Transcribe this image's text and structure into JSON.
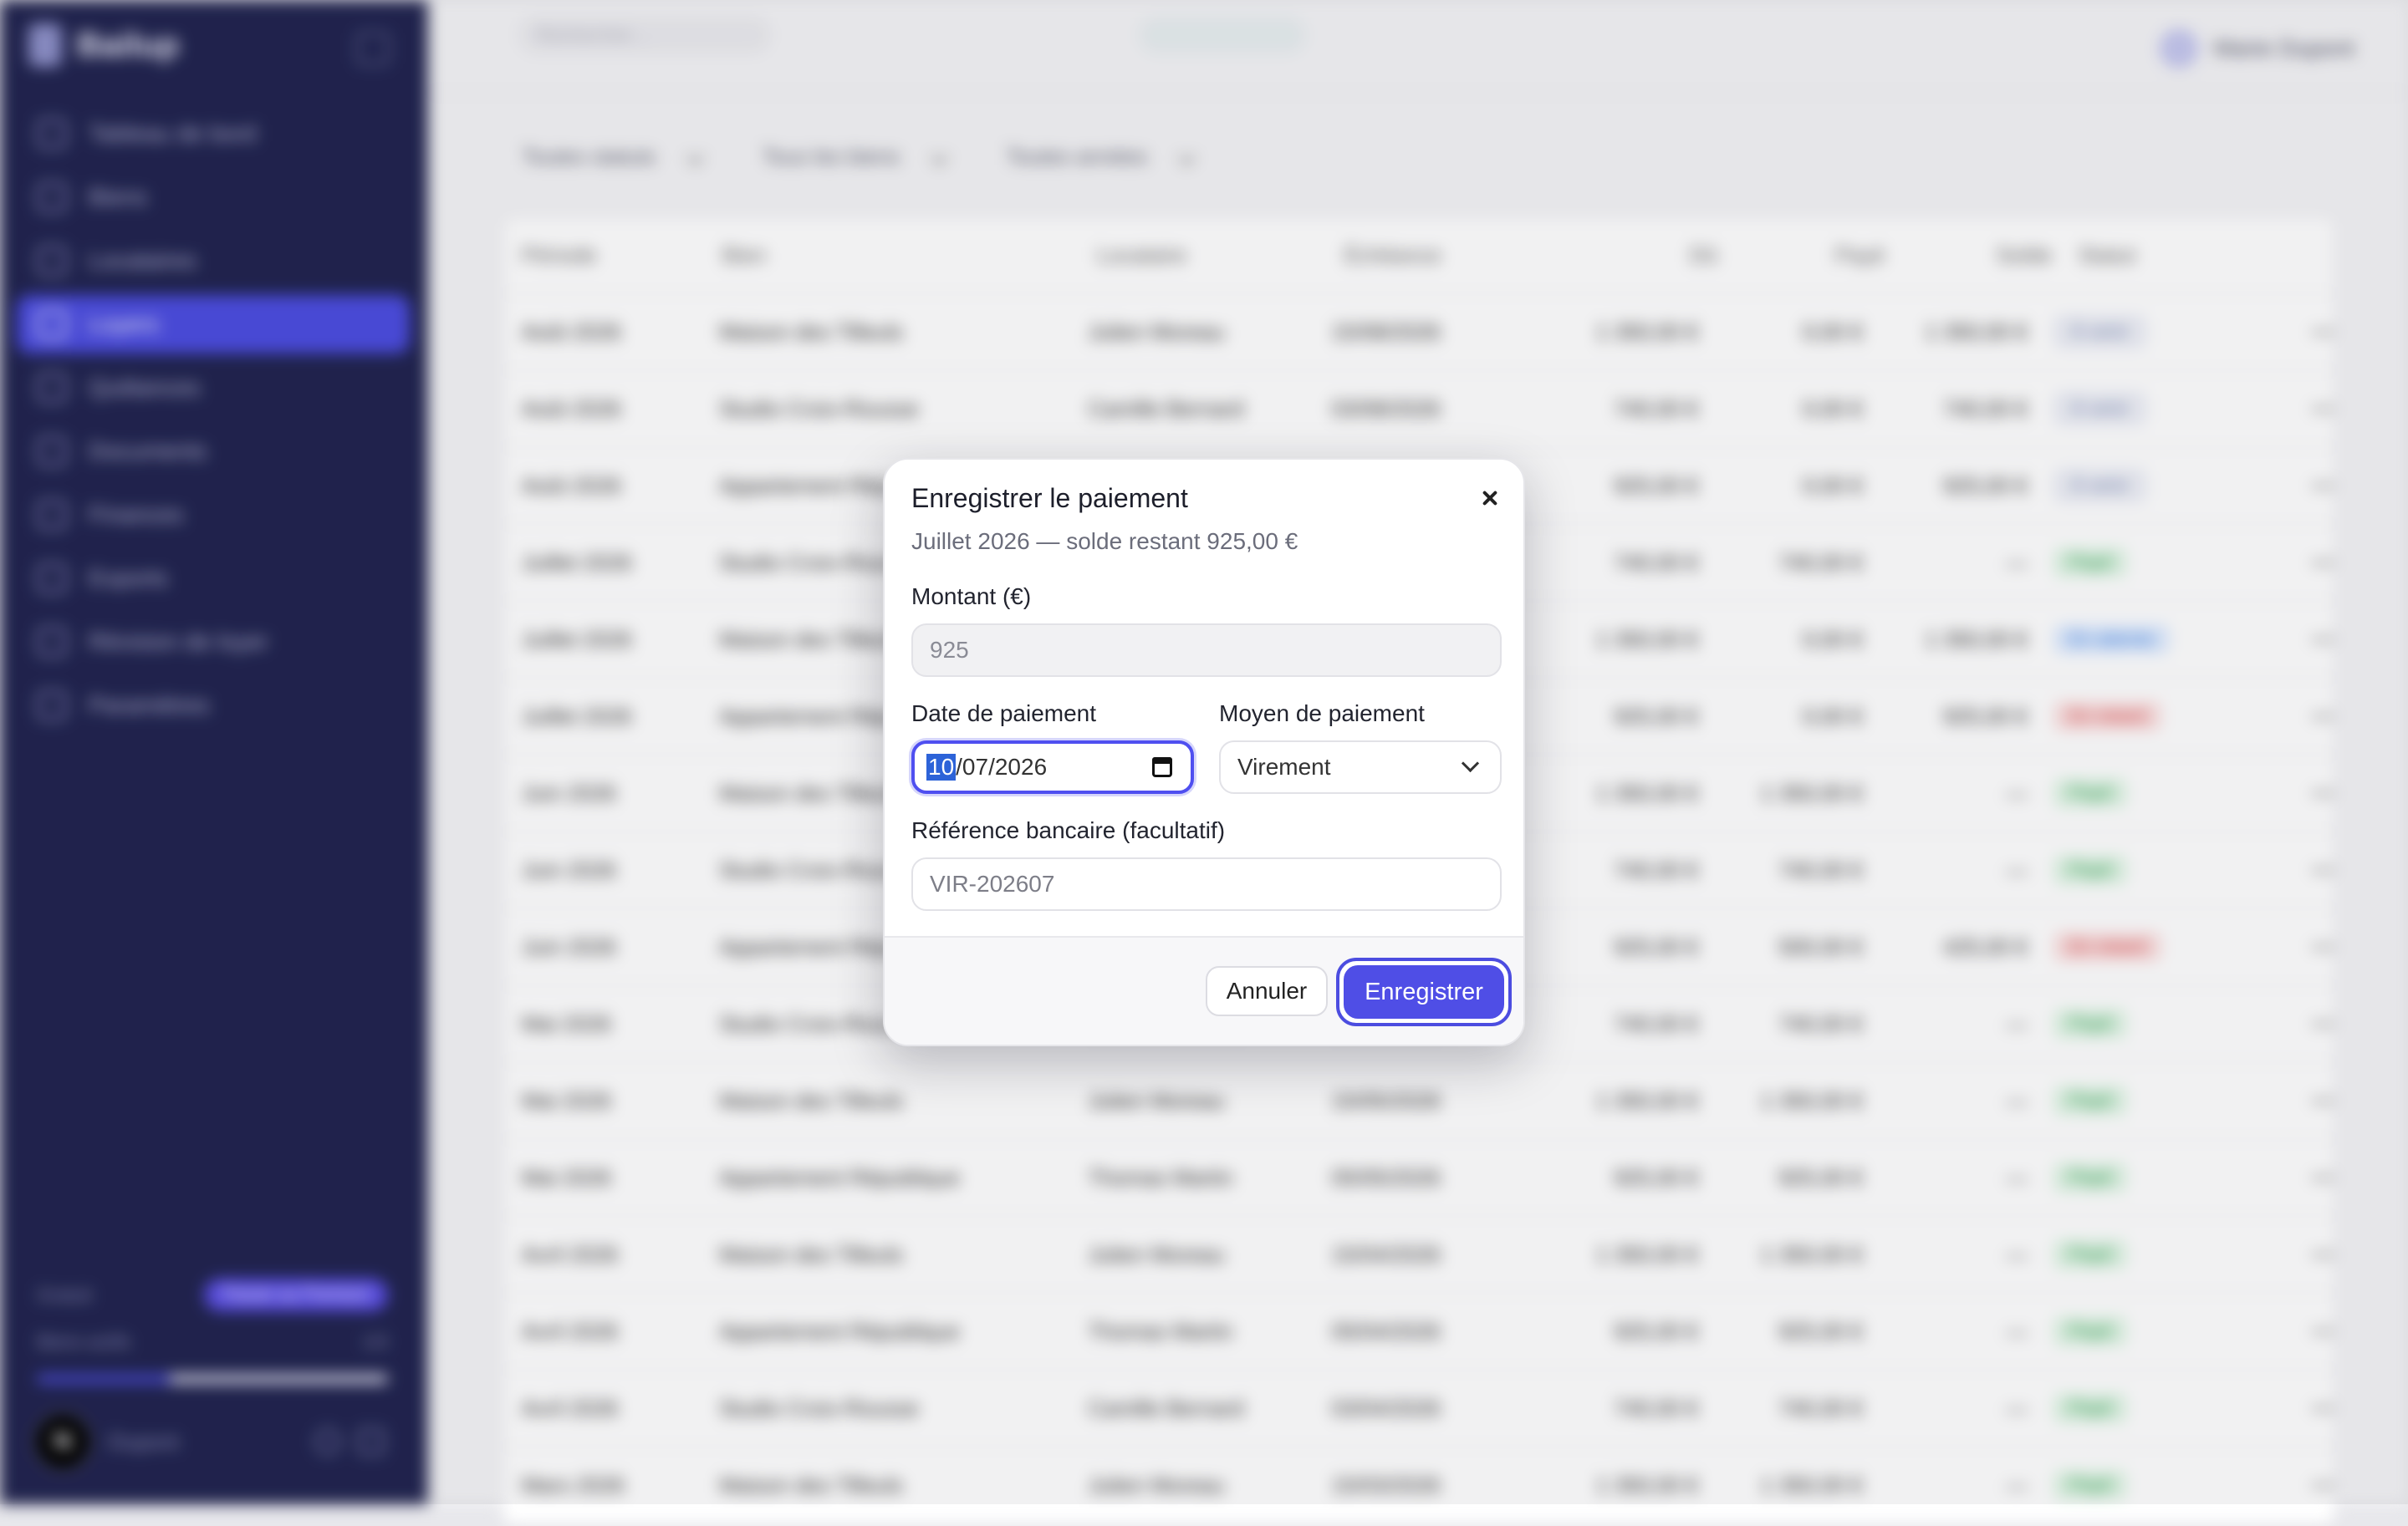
{
  "sidebar": {
    "brand": "Bailup",
    "items": [
      {
        "label": "Tableau de bord"
      },
      {
        "label": "Biens"
      },
      {
        "label": "Locataires"
      },
      {
        "label": "Loyers",
        "active": true
      },
      {
        "label": "Quittances"
      },
      {
        "label": "Documents"
      },
      {
        "label": "Finances"
      },
      {
        "label": "Exports"
      },
      {
        "label": "Révision de loyer"
      },
      {
        "label": "Paramètres"
      }
    ],
    "plan": {
      "name": "Gratuit",
      "badge": "Passer au Premium",
      "usage_label": "Biens actifs",
      "usage_value": "1/3",
      "usage_fraction": 0.38
    },
    "user_initial": "N",
    "user_name": "Dupont"
  },
  "topbar": {
    "search_placeholder": "Rechercher…",
    "user_name": "Marie Dupont"
  },
  "filters": [
    "Toutes statuts",
    "Tous les biens",
    "Toutes années"
  ],
  "table": {
    "headers": [
      "Période",
      "Bien",
      "Locataire",
      "Échéance",
      "Dû",
      "Payé",
      "Solde",
      "Statut"
    ],
    "rows": [
      [
        "Août 2026",
        "Maison des Tilleuls",
        "Julien Moreau",
        "15/08/2026",
        "1 350,00 €",
        "0,00 €",
        "1 350,00 €",
        "À venir"
      ],
      [
        "Août 2026",
        "Studio Croix-Rousse",
        "Camille Bernard",
        "03/08/2026",
        "740,00 €",
        "0,00 €",
        "740,00 €",
        "À venir"
      ],
      [
        "Août 2026",
        "Appartement République",
        "Thomas Martin",
        "05/08/2026",
        "925,00 €",
        "0,00 €",
        "925,00 €",
        "À venir"
      ],
      [
        "Juillet 2026",
        "Studio Croix-Rousse",
        "Camille Bernard",
        "03/07/2026",
        "740,00 €",
        "740,00 €",
        "—",
        "Payé"
      ],
      [
        "Juillet 2026",
        "Maison des Tilleuls",
        "Julien Moreau",
        "15/07/2026",
        "1 350,00 €",
        "0,00 €",
        "1 350,00 €",
        "En attente"
      ],
      [
        "Juillet 2026",
        "Appartement République",
        "Thomas Martin",
        "05/07/2026",
        "925,00 €",
        "0,00 €",
        "925,00 €",
        "En retard"
      ],
      [
        "Juin 2026",
        "Maison des Tilleuls",
        "Julien Moreau",
        "15/06/2026",
        "1 350,00 €",
        "1 350,00 €",
        "—",
        "Payé"
      ],
      [
        "Juin 2026",
        "Studio Croix-Rousse",
        "Camille Bernard",
        "03/06/2026",
        "740,00 €",
        "740,00 €",
        "—",
        "Payé"
      ],
      [
        "Juin 2026",
        "Appartement République",
        "Thomas Martin",
        "05/06/2026",
        "925,00 €",
        "500,00 €",
        "425,00 €",
        "En retard"
      ],
      [
        "Mai 2026",
        "Studio Croix-Rousse",
        "Camille Bernard",
        "03/05/2026",
        "740,00 €",
        "740,00 €",
        "—",
        "Payé"
      ],
      [
        "Mai 2026",
        "Maison des Tilleuls",
        "Julien Moreau",
        "15/05/2026",
        "1 350,00 €",
        "1 350,00 €",
        "—",
        "Payé"
      ],
      [
        "Mai 2026",
        "Appartement République",
        "Thomas Martin",
        "05/05/2026",
        "925,00 €",
        "925,00 €",
        "—",
        "Payé"
      ],
      [
        "Avril 2026",
        "Maison des Tilleuls",
        "Julien Moreau",
        "15/04/2026",
        "1 350,00 €",
        "1 350,00 €",
        "—",
        "Payé"
      ],
      [
        "Avril 2026",
        "Appartement République",
        "Thomas Martin",
        "05/04/2026",
        "925,00 €",
        "925,00 €",
        "—",
        "Payé"
      ],
      [
        "Avril 2026",
        "Studio Croix-Rousse",
        "Camille Bernard",
        "03/04/2026",
        "740,00 €",
        "740,00 €",
        "—",
        "Payé"
      ],
      [
        "Mars 2026",
        "Maison des Tilleuls",
        "Julien Moreau",
        "15/03/2026",
        "1 350,00 €",
        "1 350,00 €",
        "—",
        "Payé"
      ]
    ],
    "row_menu_glyph": "•••"
  },
  "modal": {
    "title": "Enregistrer le paiement",
    "subtitle": "Juillet 2026 — solde restant 925,00 €",
    "amount_label": "Montant (€)",
    "amount_value": "925",
    "date_label": "Date de paiement",
    "date_day": "10",
    "date_rest": "/07/2026",
    "method_label": "Moyen de paiement",
    "method_value": "Virement",
    "reference_label": "Référence bancaire (facultatif)",
    "reference_placeholder": "VIR-202607",
    "cancel_label": "Annuler",
    "save_label": "Enregistrer"
  },
  "colors": {
    "sidebar_bg": "#21244f",
    "accent": "#4f4ee6",
    "paid": "#2e9a4c",
    "late": "#d64040",
    "pending": "#3a7be0"
  }
}
